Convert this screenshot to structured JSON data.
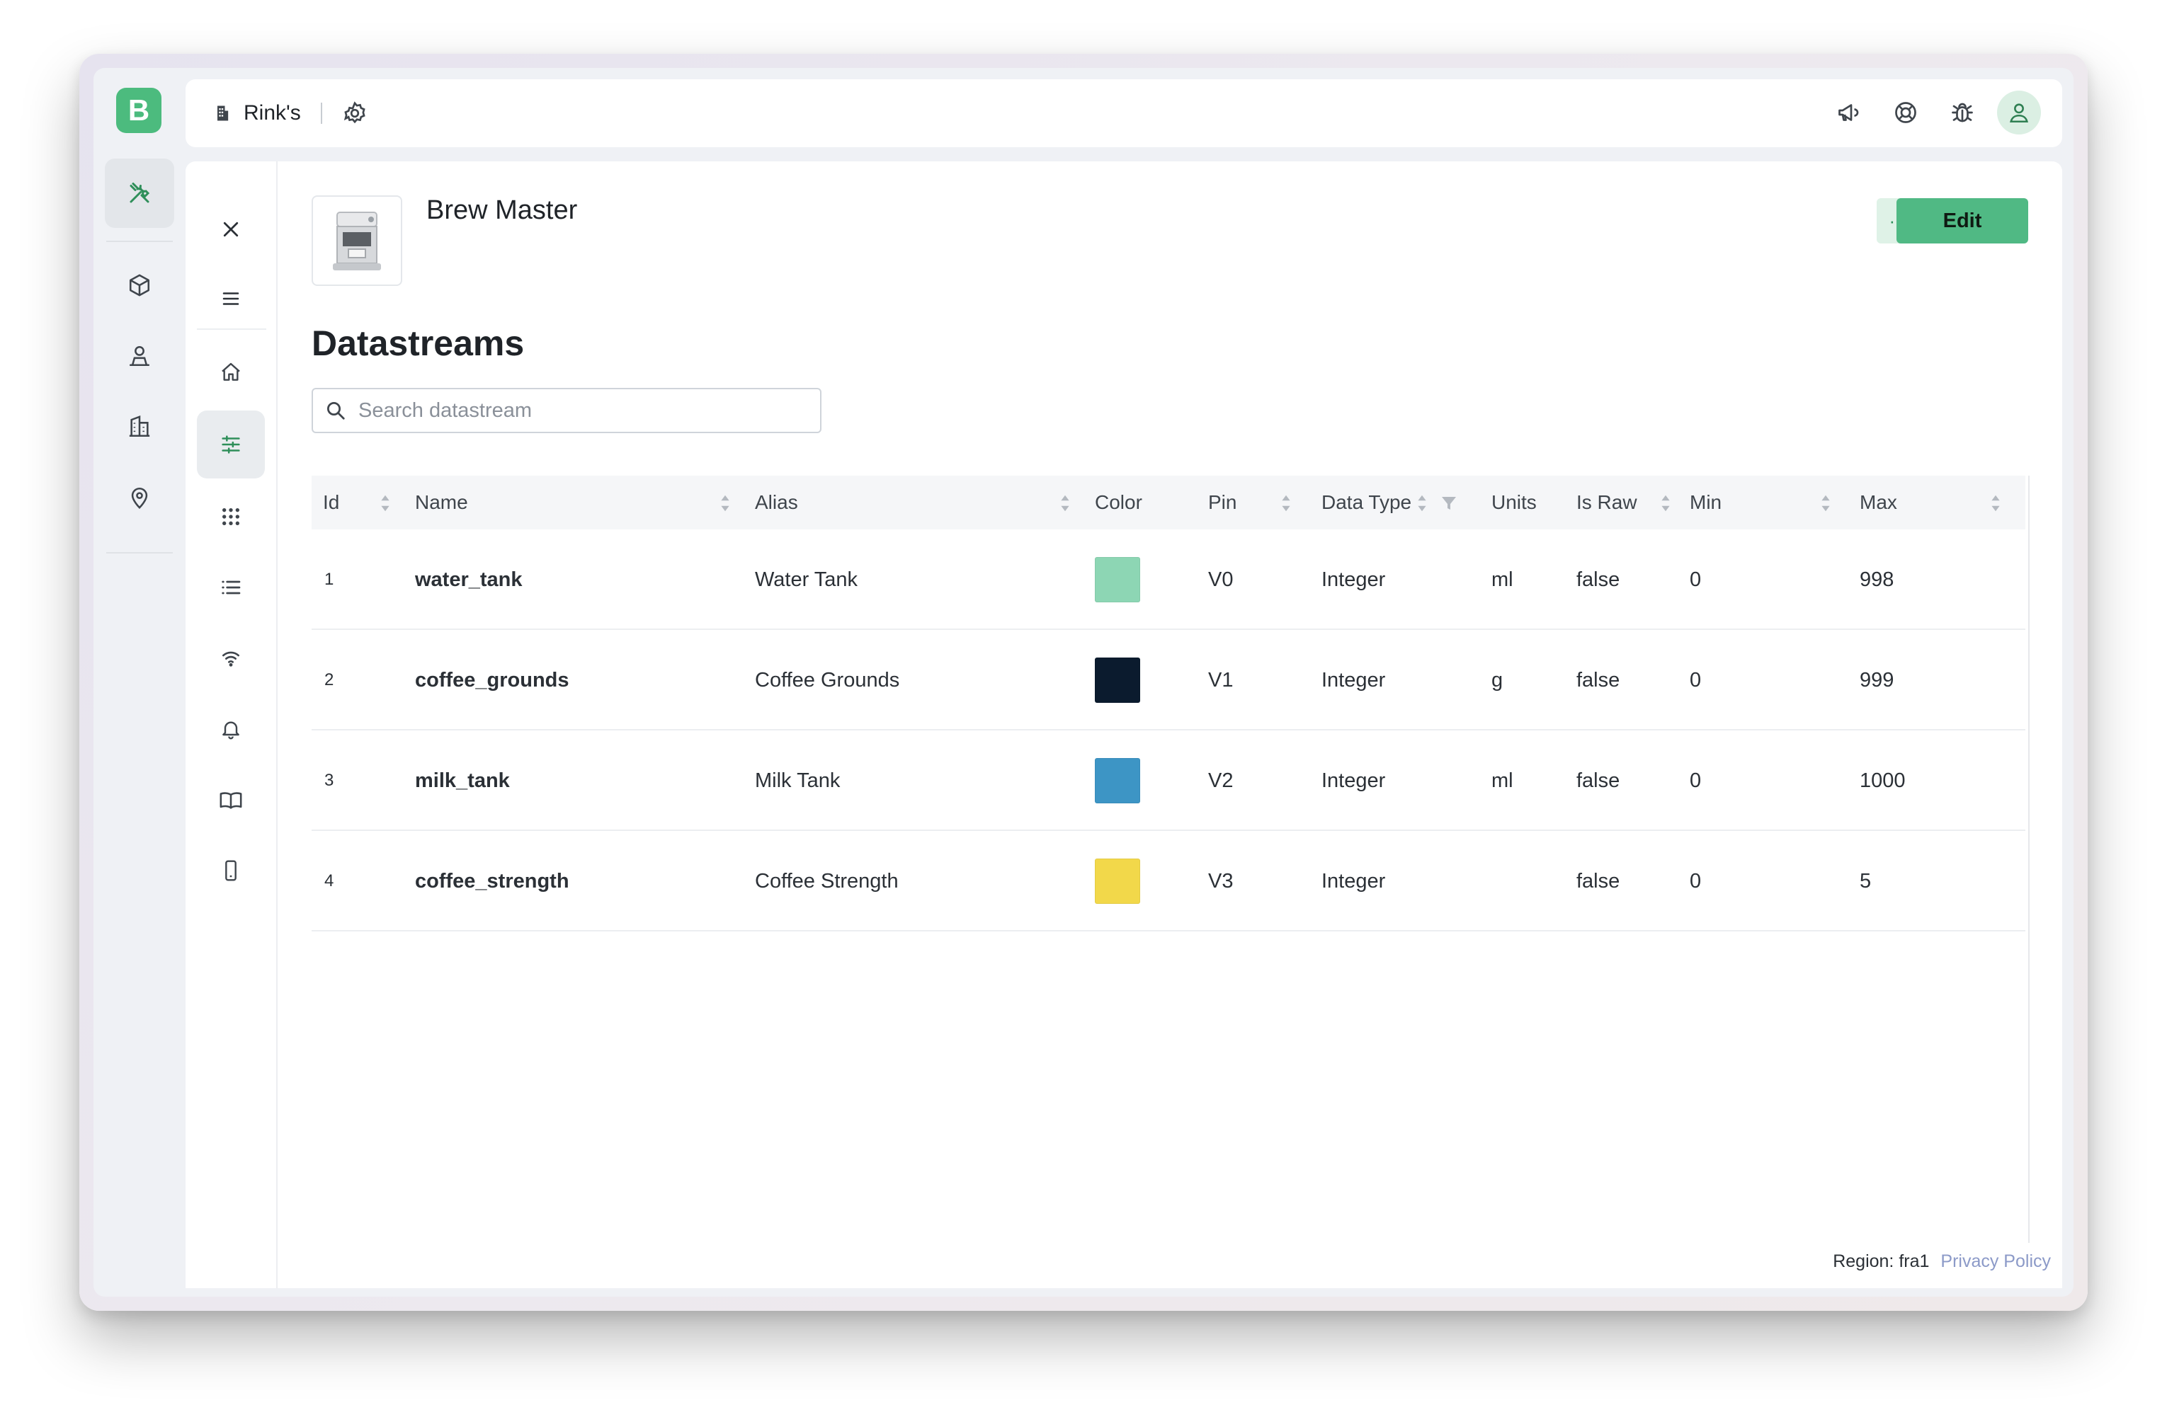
{
  "app": {
    "logo_letter": "B",
    "brand_color": "#4cbb7e"
  },
  "topbar": {
    "org_name": "Rink's",
    "icons": [
      "building-icon",
      "settings-icon",
      "megaphone-icon",
      "help-ring-icon",
      "bug-icon",
      "user-avatar-icon"
    ]
  },
  "rail": {
    "items": [
      "tools-icon",
      "cube-icon",
      "stamp-icon",
      "buildings-icon",
      "location-pin-icon"
    ]
  },
  "subnav": {
    "items": [
      "close-icon",
      "menu-icon",
      "home-icon",
      "datastreams-icon",
      "grid-icon",
      "list-icon",
      "wireless-icon",
      "bell-icon",
      "book-icon",
      "mobile-icon"
    ]
  },
  "product": {
    "name": "Brew Master",
    "more_label": "···",
    "edit_label": "Edit"
  },
  "section": {
    "title": "Datastreams"
  },
  "search": {
    "placeholder": "Search datastream"
  },
  "table": {
    "columns": [
      "Id",
      "Name",
      "Alias",
      "Color",
      "Pin",
      "Data Type",
      "Units",
      "Is Raw",
      "Min",
      "Max"
    ],
    "rows": [
      {
        "id": "1",
        "name": "water_tank",
        "alias": "Water Tank",
        "color": "#8dd6b4",
        "pin": "V0",
        "type": "Integer",
        "units": "ml",
        "raw": "false",
        "min": "0",
        "max": "998"
      },
      {
        "id": "2",
        "name": "coffee_grounds",
        "alias": "Coffee Grounds",
        "color": "#0b1b2e",
        "pin": "V1",
        "type": "Integer",
        "units": "g",
        "raw": "false",
        "min": "0",
        "max": "999"
      },
      {
        "id": "3",
        "name": "milk_tank",
        "alias": "Milk Tank",
        "color": "#3d95c5",
        "pin": "V2",
        "type": "Integer",
        "units": "ml",
        "raw": "false",
        "min": "0",
        "max": "1000"
      },
      {
        "id": "4",
        "name": "coffee_strength",
        "alias": "Coffee Strength",
        "color": "#f2d84a",
        "pin": "V3",
        "type": "Integer",
        "units": "",
        "raw": "false",
        "min": "0",
        "max": "5"
      }
    ]
  },
  "footer": {
    "region": "Region: fra1",
    "privacy": "Privacy Policy"
  }
}
